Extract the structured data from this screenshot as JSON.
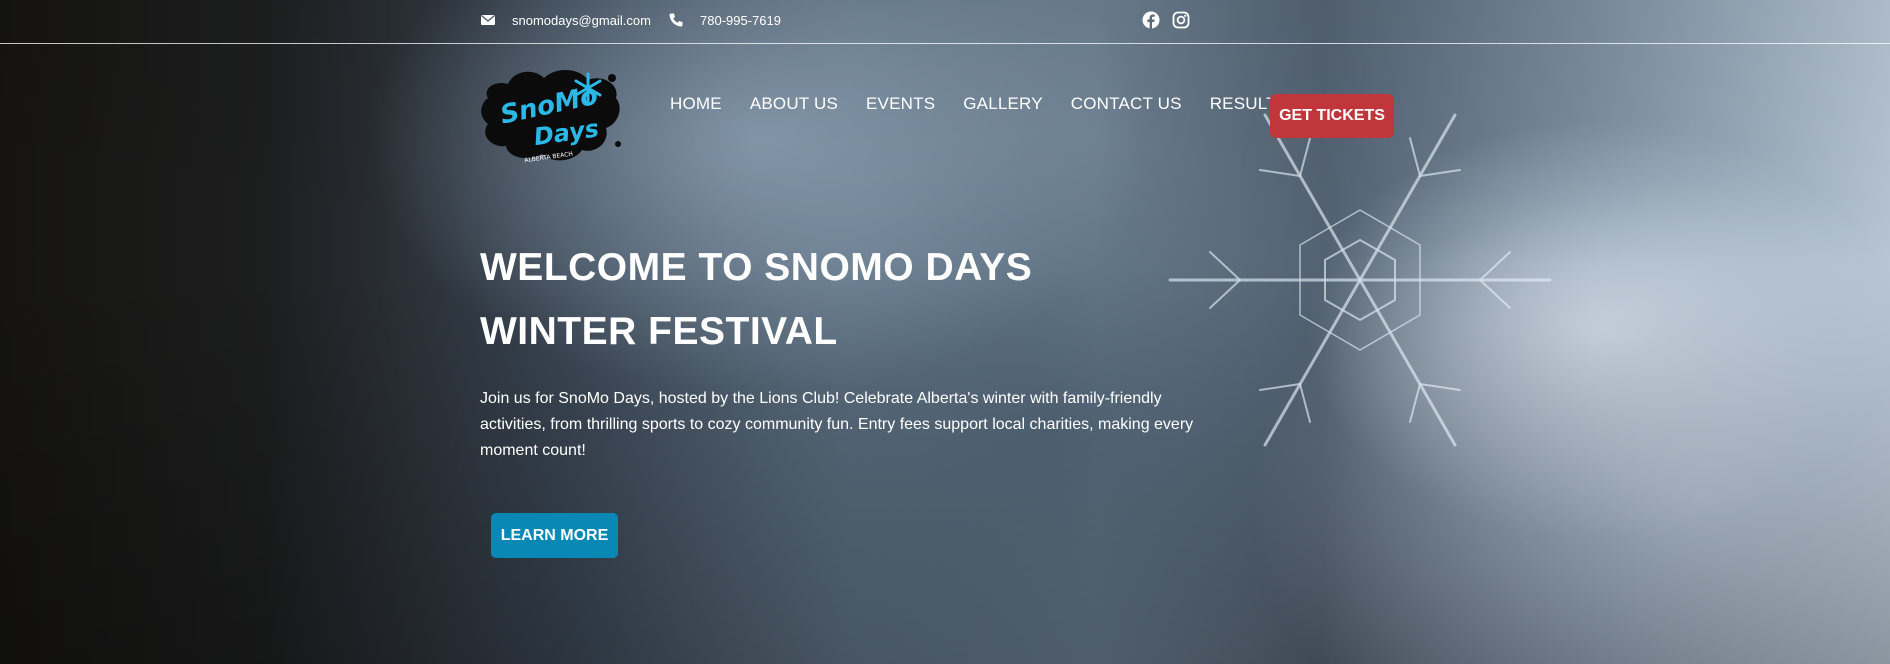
{
  "topbar": {
    "email": "snomodays@gmail.com",
    "phone": "780-995-7619",
    "icons": {
      "email": "envelope-icon",
      "phone": "phone-icon",
      "facebook": "facebook-icon",
      "instagram": "instagram-icon"
    }
  },
  "logo": {
    "line1": "SnoMo",
    "line2": "Days",
    "tagline": "ALBERTA BEACH"
  },
  "nav": {
    "items": [
      "HOME",
      "ABOUT US",
      "EVENTS",
      "GALLERY",
      "CONTACT US",
      "RESULTS"
    ],
    "cta": "GET TICKETS"
  },
  "hero": {
    "title_line1": "WELCOME TO SNOMO DAYS",
    "title_line2": "WINTER FESTIVAL",
    "intro": "Join us for SnoMo Days, hosted by the Lions Club! Celebrate Alberta's winter with family-friendly activities, from thrilling sports to cozy community fun. Entry fees support local charities, making every moment count!",
    "button": "LEARN MORE"
  },
  "colors": {
    "cta": "#c0363a",
    "learn_more": "#0a88b5",
    "logo_accent": "#2bb8e6"
  }
}
